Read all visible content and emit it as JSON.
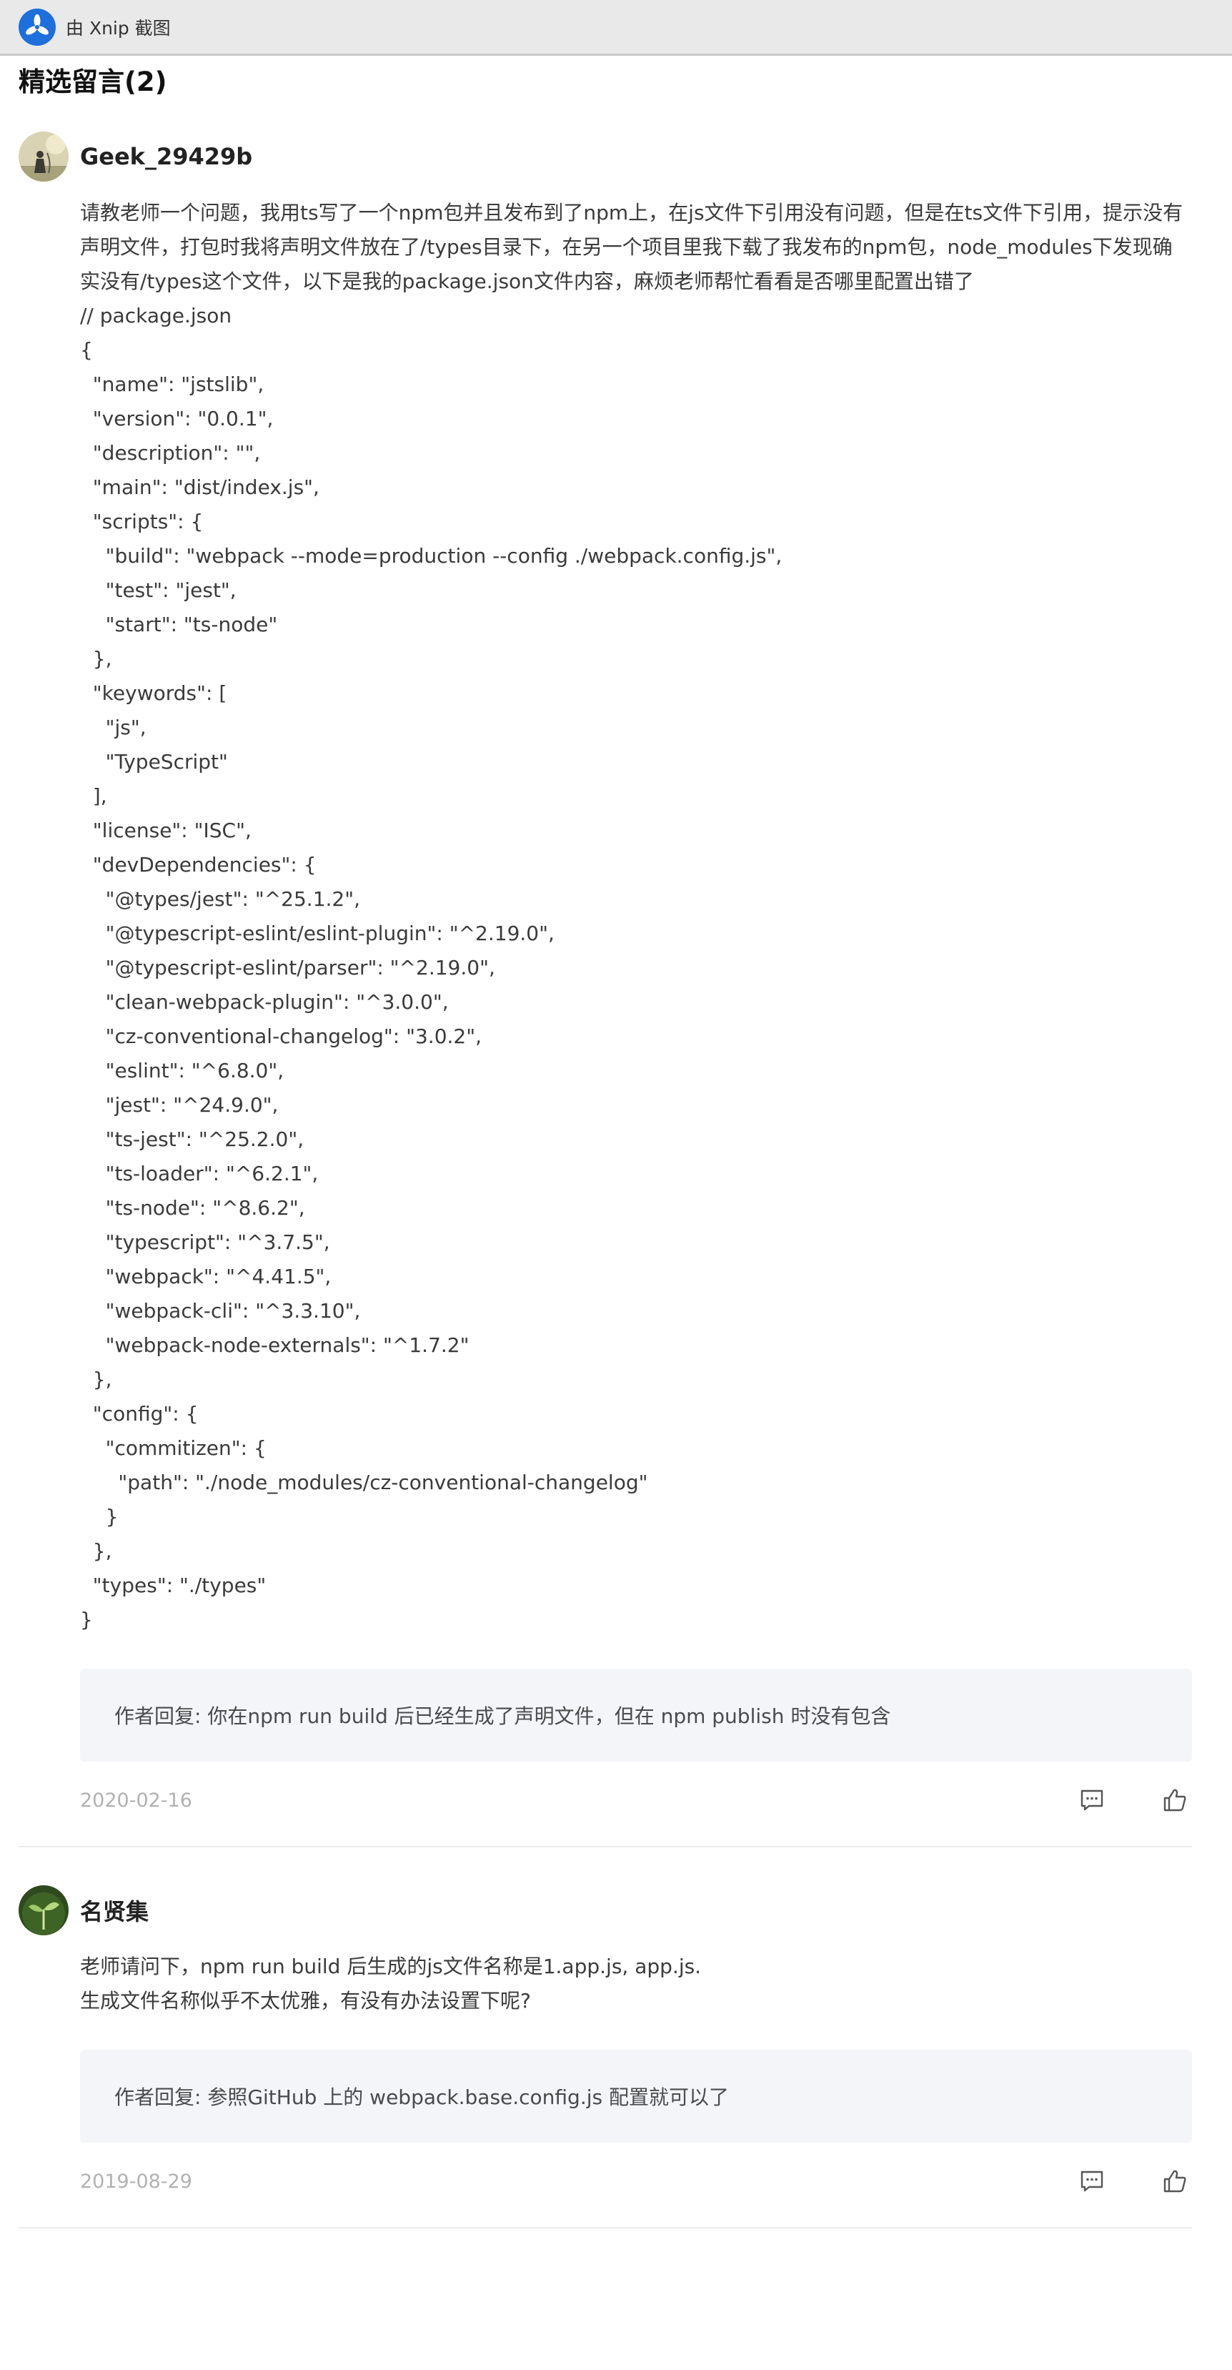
{
  "window": {
    "title": "由 Xnip 截图"
  },
  "section_title": "精选留言(2)",
  "comments": [
    {
      "author": "Geek_29429b",
      "body_intro": "请教老师一个问题，我用ts写了一个npm包并且发布到了npm上，在js文件下引用没有问题，但是在ts文件下引用，提示没有声明文件，打包时我将声明文件放在了/types目录下，在另一个项目里我下载了我发布的npm包，node_modules下发现确实没有/types这个文件，以下是我的package.json文件内容，麻烦老师帮忙看看是否哪里配置出错了",
      "code_lines": [
        "// package.json",
        "{",
        "  \"name\": \"jstslib\",",
        "  \"version\": \"0.0.1\",",
        "  \"description\": \"\",",
        "  \"main\": \"dist/index.js\",",
        "  \"scripts\": {",
        "    \"build\": \"webpack --mode=production --config ./webpack.config.js\",",
        "    \"test\": \"jest\",",
        "    \"start\": \"ts-node\"",
        "  },",
        "  \"keywords\": [",
        "    \"js\",",
        "    \"TypeScript\"",
        "  ],",
        "  \"license\": \"ISC\",",
        "  \"devDependencies\": {",
        "    \"@types/jest\": \"^25.1.2\",",
        "    \"@typescript-eslint/eslint-plugin\": \"^2.19.0\",",
        "    \"@typescript-eslint/parser\": \"^2.19.0\",",
        "    \"clean-webpack-plugin\": \"^3.0.0\",",
        "    \"cz-conventional-changelog\": \"3.0.2\",",
        "    \"eslint\": \"^6.8.0\",",
        "    \"jest\": \"^24.9.0\",",
        "    \"ts-jest\": \"^25.2.0\",",
        "    \"ts-loader\": \"^6.2.1\",",
        "    \"ts-node\": \"^8.6.2\",",
        "    \"typescript\": \"^3.7.5\",",
        "    \"webpack\": \"^4.41.5\",",
        "    \"webpack-cli\": \"^3.3.10\",",
        "    \"webpack-node-externals\": \"^1.7.2\"",
        "  },",
        "  \"config\": {",
        "    \"commitizen\": {",
        "      \"path\": \"./node_modules/cz-conventional-changelog\"",
        "    }",
        "  },",
        "  \"types\": \"./types\"",
        "}"
      ],
      "reply": "作者回复: 你在npm run build 后已经生成了声明文件，但在 npm publish 时没有包含",
      "date": "2020-02-16"
    },
    {
      "author": "名贤集",
      "body_lines": [
        "老师请问下，npm run build 后生成的js文件名称是1.app.js, app.js.",
        "生成文件名称似乎不太优雅，有没有办法设置下呢?"
      ],
      "reply": "作者回复: 参照GitHub 上的 webpack.base.config.js 配置就可以了",
      "date": "2019-08-29"
    }
  ],
  "icons": {
    "logo": "xnip-logo-icon",
    "comment": "comment-icon",
    "like": "thumbs-up-icon"
  },
  "colors": {
    "reply_background": "#f4f5f9",
    "date_text": "#b1b1b1",
    "logo": "#1d6fdc"
  }
}
